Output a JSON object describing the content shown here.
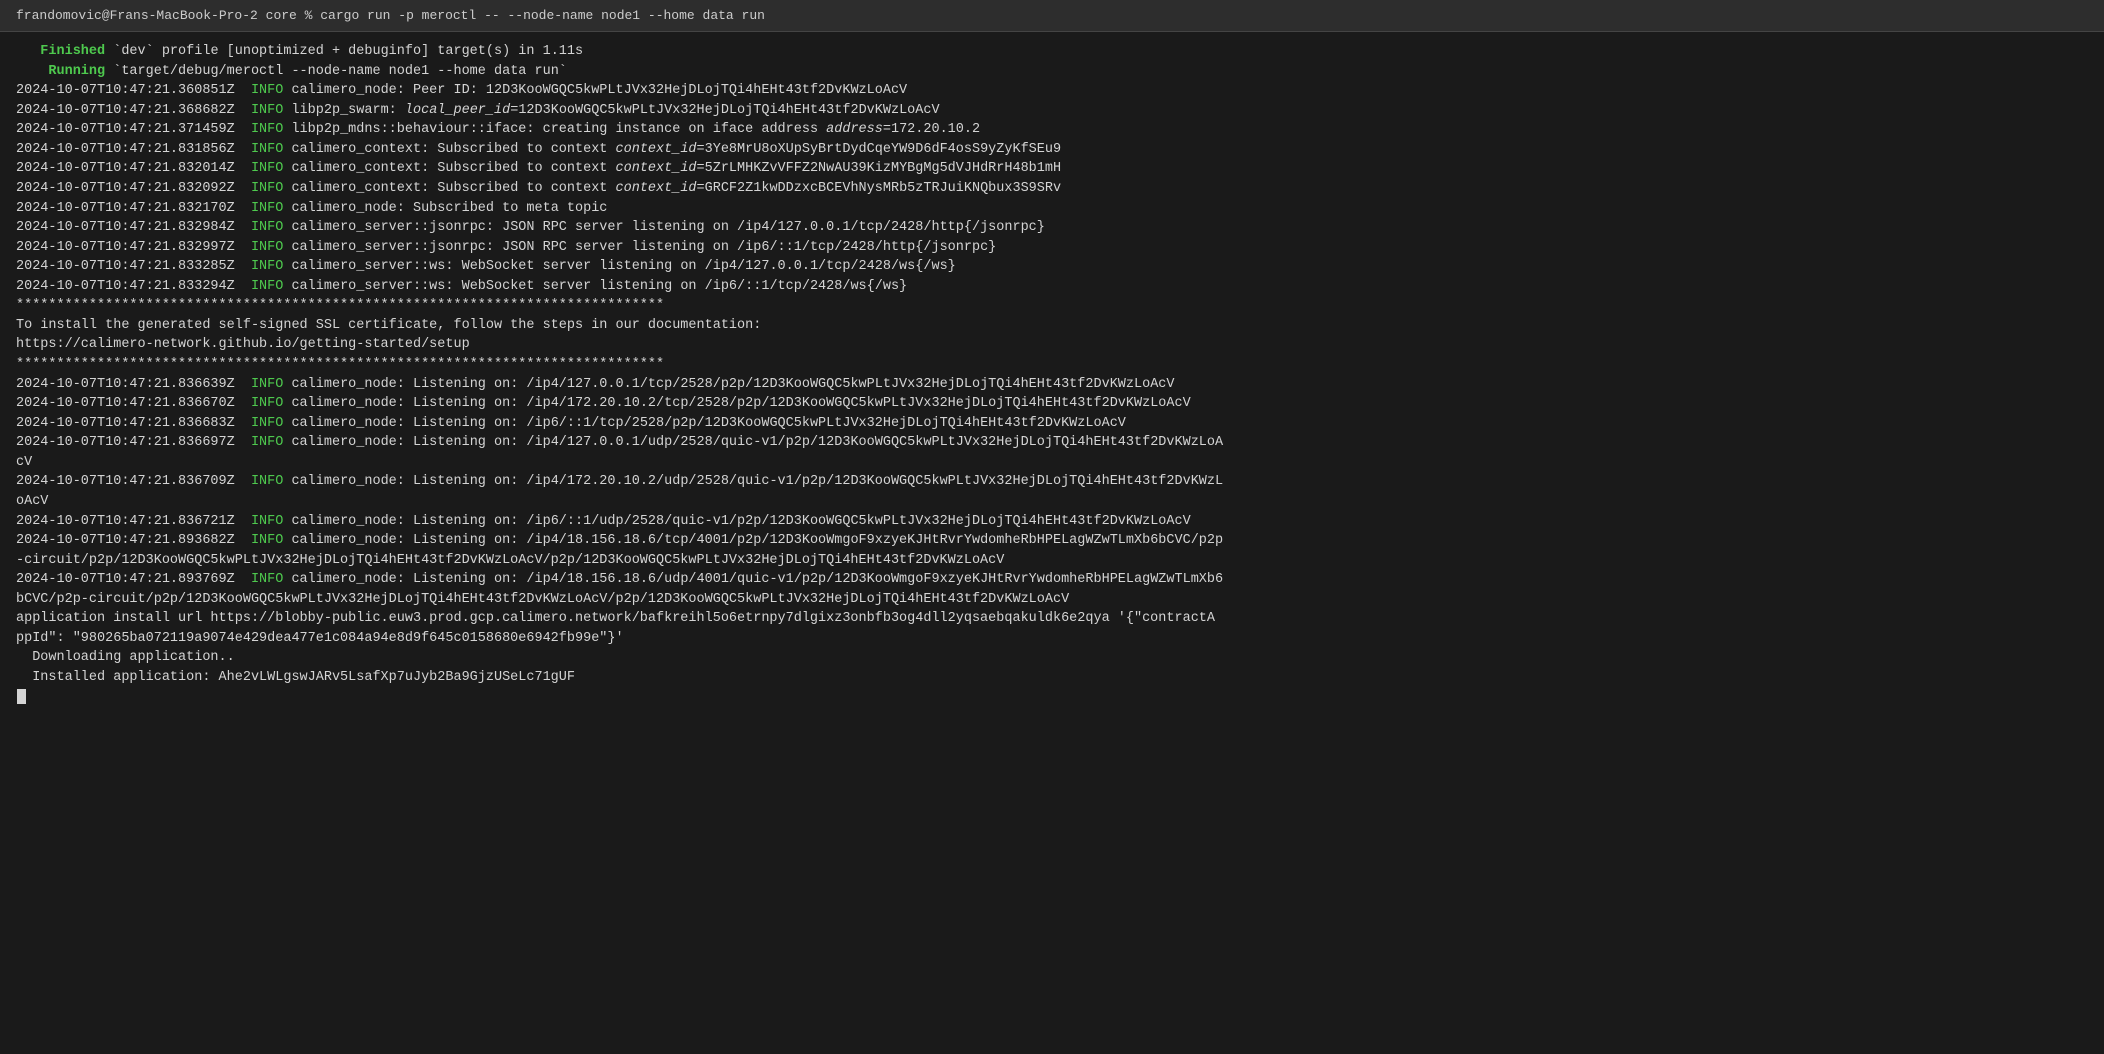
{
  "terminal": {
    "title": "frandomovic@Frans-MacBook-Pro-2 core % cargo run -p meroctl -- --node-name node1 --home data run",
    "lines": [
      {
        "id": "title-bar",
        "text": "frandomovic@Frans-MacBook-Pro-2 core % cargo run -p meroctl -- --node-name node1 --home data run",
        "type": "title"
      },
      {
        "id": "finished",
        "type": "finished",
        "prefix": "   Finished",
        "rest": " `dev` profile [unoptimized + debuginfo] target(s) in 1.11s"
      },
      {
        "id": "running",
        "type": "running",
        "prefix": "    Running",
        "rest": " `target/debug/meroctl --node-name node1 --home data run`"
      },
      {
        "id": "log1",
        "type": "log",
        "text": "2024-10-07T10:47:21.360851Z  INFO calimero_node: Peer ID: 12D3KooWGQC5kwPLtJVx32HejDLojTQi4hEHt43tf2DvKWzLoAcV"
      },
      {
        "id": "log2",
        "type": "log",
        "text": "2024-10-07T10:47:21.368682Z  INFO libp2p_swarm: local_peer_id=12D3KooWGQC5kwPLtJVx32HejDLojTQi4hEHt43tf2DvKWzLoAcV"
      },
      {
        "id": "log3",
        "type": "log",
        "text": "2024-10-07T10:47:21.371459Z  INFO libp2p_mdns::behaviour::iface: creating instance on iface address address=172.20.10.2"
      },
      {
        "id": "log4",
        "type": "log",
        "text": "2024-10-07T10:47:21.831856Z  INFO calimero_context: Subscribed to context context_id=3Ye8MrU8oXUpSyBrtDydCqeYW9D6dF4osS9yZyKfSEu9"
      },
      {
        "id": "log5",
        "type": "log",
        "text": "2024-10-07T10:47:21.832014Z  INFO calimero_context: Subscribed to context context_id=5ZrLMHKZvVFFZ2NwAU39KizMYBgMg5dVJHdRrH48b1mH"
      },
      {
        "id": "log6",
        "type": "log",
        "text": "2024-10-07T10:47:21.832092Z  INFO calimero_context: Subscribed to context context_id=GRCF2Z1kwDDzxcBCEVhNysMRb5zTRJuiKNQbux3S9SRv"
      },
      {
        "id": "log7",
        "type": "log",
        "text": "2024-10-07T10:47:21.832170Z  INFO calimero_node: Subscribed to meta topic"
      },
      {
        "id": "log8",
        "type": "log",
        "text": "2024-10-07T10:47:21.832984Z  INFO calimero_server::jsonrpc: JSON RPC server listening on /ip4/127.0.0.1/tcp/2428/http{/jsonrpc}"
      },
      {
        "id": "log9",
        "type": "log",
        "text": "2024-10-07T10:47:21.832997Z  INFO calimero_server::jsonrpc: JSON RPC server listening on /ip6/::1/tcp/2428/http{/jsonrpc}"
      },
      {
        "id": "log10",
        "type": "log",
        "text": "2024-10-07T10:47:21.833285Z  INFO calimero_server::ws: WebSocket server listening on /ip4/127.0.0.1/tcp/2428/ws{/ws}"
      },
      {
        "id": "log11",
        "type": "log",
        "text": "2024-10-07T10:47:21.833294Z  INFO calimero_server::ws: WebSocket server listening on /ip6/::1/tcp/2428/ws{/ws}"
      },
      {
        "id": "stars1",
        "type": "stars",
        "text": "********************************************************************************"
      },
      {
        "id": "ssl1",
        "type": "plain",
        "text": "To install the generated self-signed SSL certificate, follow the steps in our documentation:"
      },
      {
        "id": "ssl2",
        "type": "plain",
        "text": "https://calimero-network.github.io/getting-started/setup"
      },
      {
        "id": "stars2",
        "type": "stars",
        "text": "********************************************************************************"
      },
      {
        "id": "log12",
        "type": "log",
        "text": "2024-10-07T10:47:21.836639Z  INFO calimero_node: Listening on: /ip4/127.0.0.1/tcp/2528/p2p/12D3KooWGQC5kwPLtJVx32HejDLojTQi4hEHt43tf2DvKWzLoAcV"
      },
      {
        "id": "log13",
        "type": "log",
        "text": "2024-10-07T10:47:21.836670Z  INFO calimero_node: Listening on: /ip4/172.20.10.2/tcp/2528/p2p/12D3KooWGQC5kwPLtJVx32HejDLojTQi4hEHt43tf2DvKWzLoAcV"
      },
      {
        "id": "log14",
        "type": "log",
        "text": "2024-10-07T10:47:21.836683Z  INFO calimero_node: Listening on: /ip6/::1/tcp/2528/p2p/12D3KooWGQC5kwPLtJVx32HejDLojTQi4hEHt43tf2DvKWzLoAcV"
      },
      {
        "id": "log15",
        "type": "log",
        "text": "2024-10-07T10:47:21.836697Z  INFO calimero_node: Listening on: /ip4/127.0.0.1/udp/2528/quic-v1/p2p/12D3KooWGQC5kwPLtJVx32HejDLojTQi4hEHt43tf2DvKWzLoAcV"
      },
      {
        "id": "log15b",
        "type": "continuation",
        "text": "cV"
      },
      {
        "id": "log16",
        "type": "log",
        "text": "2024-10-07T10:47:21.836709Z  INFO calimero_node: Listening on: /ip4/172.20.10.2/udp/2528/quic-v1/p2p/12D3KooWGQC5kwPLtJVx32HejDLojTQi4hEHt43tf2DvKWzL"
      },
      {
        "id": "log16b",
        "type": "continuation",
        "text": "oAcV"
      },
      {
        "id": "log17",
        "type": "log",
        "text": "2024-10-07T10:47:21.836721Z  INFO calimero_node: Listening on: /ip6/::1/udp/2528/quic-v1/p2p/12D3KooWGQC5kwPLtJVx32HejDLojTQi4hEHt43tf2DvKWzLoAcV"
      },
      {
        "id": "log18",
        "type": "log",
        "text": "2024-10-07T10:47:21.893682Z  INFO calimero_node: Listening on: /ip4/18.156.18.6/tcp/4001/p2p/12D3KooWmgoF9xzyeKJHtRvrYwdomheRbHPELagWZwTLmXb6bCVC/p2p"
      },
      {
        "id": "log18b",
        "type": "continuation",
        "text": "-circuit/p2p/12D3KooWGQC5kwPLtJVx32HejDLojTQi4hEHt43tf2DvKWzLoAcV/p2p/12D3KooWGQC5kwPLtJVx32HejDLojTQi4hEHt43tf2DvKWzLoAcV"
      },
      {
        "id": "log19",
        "type": "log",
        "text": "2024-10-07T10:47:21.893769Z  INFO calimero_node: Listening on: /ip4/18.156.18.6/udp/4001/quic-v1/p2p/12D3KooWmgoF9xzyeKJHtRvrYwdomheRbHPELagWZwTLmXb6"
      },
      {
        "id": "log19b",
        "type": "continuation",
        "text": "bCVC/p2p-circuit/p2p/12D3KooWGQC5kwPLtJVx32HejDLojTQi4hEHt43tf2DvKWzLoAcV/p2p/12D3KooWGQC5kwPLtJVx32HejDLojTQi4hEHt43tf2DvKWzLoAcV"
      },
      {
        "id": "app1",
        "type": "plain",
        "text": "application install url https://blobby-public.euw3.prod.gcp.calimero.network/bafkreihl5o6etrnpy7dlgixz3onbfb3og4dll2yqsaebqakuldk6e2qya '{\"contractA"
      },
      {
        "id": "app2",
        "type": "plain",
        "text": "ppId\": \"980265ba072119a9074e429dea477e1c084a94e8d9f645c0158680e6942fb99e\"}'"
      },
      {
        "id": "downloading",
        "type": "plain",
        "text": "  Downloading application.."
      },
      {
        "id": "installed",
        "type": "plain",
        "text": "  Installed application: Ahe2vLWLgswJARv5LsafXp7uJyb2Ba9GjzUSeLc71gUF"
      }
    ]
  }
}
